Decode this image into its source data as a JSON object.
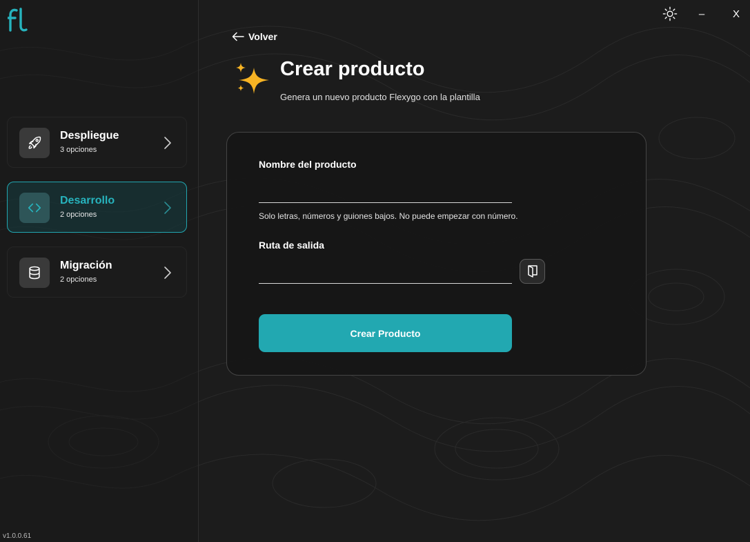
{
  "window": {
    "theme_icon": "sun-icon",
    "minimize_label": "–",
    "close_label": "X"
  },
  "sidebar": {
    "logo_icon": "fl-logo-icon",
    "items": [
      {
        "title": "Despliegue",
        "subtitle": "3 opciones",
        "icon": "rocket-icon",
        "active": false
      },
      {
        "title": "Desarrollo",
        "subtitle": "2 opciones",
        "icon": "code-icon",
        "active": true
      },
      {
        "title": "Migración",
        "subtitle": "2 opciones",
        "icon": "database-icon",
        "active": false
      }
    ],
    "version": "v1.0.0.61"
  },
  "main": {
    "back_label": "Volver",
    "title": "Crear producto",
    "subtitle": "Genera un nuevo producto Flexygo con la plantilla",
    "form": {
      "name_label": "Nombre del producto",
      "name_value": "",
      "name_placeholder": "",
      "name_hint": "Solo letras, números y guiones bajos. No puede empezar con número.",
      "path_label": "Ruta de salida",
      "path_value": "",
      "path_placeholder": "",
      "browse_icon": "folder-icon",
      "submit_label": "Crear Producto"
    }
  },
  "colors": {
    "accent": "#22a8b1",
    "background": "#1c1c1c",
    "card": "#161616",
    "sparkle": "#f6b324"
  }
}
